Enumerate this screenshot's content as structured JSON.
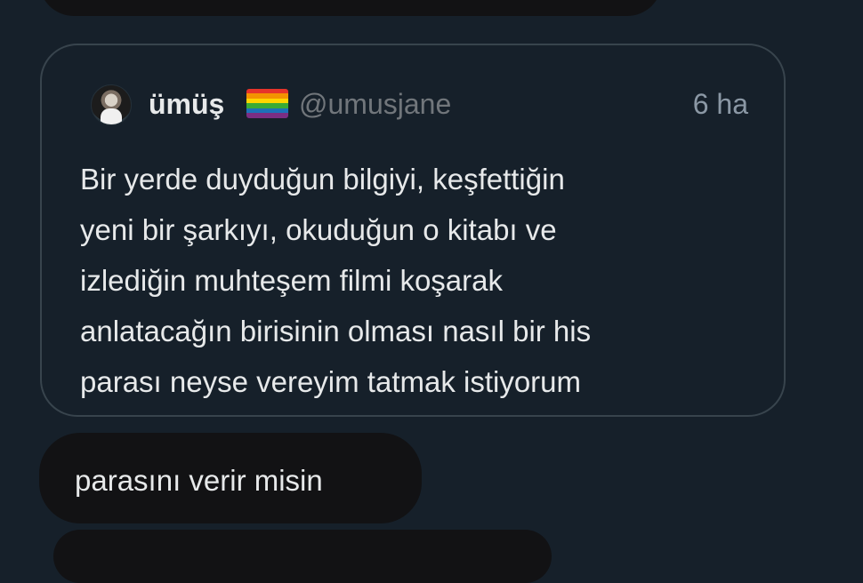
{
  "quoted_tweet": {
    "author_name": "ümüş",
    "author_flag_icon": "rainbow-flag-icon",
    "handle": "@umusjane",
    "timestamp": "6 ha",
    "text_lines": [
      "Bir yerde duyduğun bilgiyi, keşfettiğin",
      "yeni bir şarkıyı, okuduğun o kitabı ve",
      "izlediğin muhteşem filmi koşarak",
      "anlatacağın birisinin olması nasıl bir his",
      "parası neyse vereyim tatmak istiyorum"
    ]
  },
  "reply_message": {
    "text": "parasını verir misin"
  },
  "colors": {
    "background": "#16202a",
    "bubble": "#121214",
    "card_border": "#38444d",
    "primary_text": "#e7e9ea",
    "secondary_text": "#71767b"
  }
}
